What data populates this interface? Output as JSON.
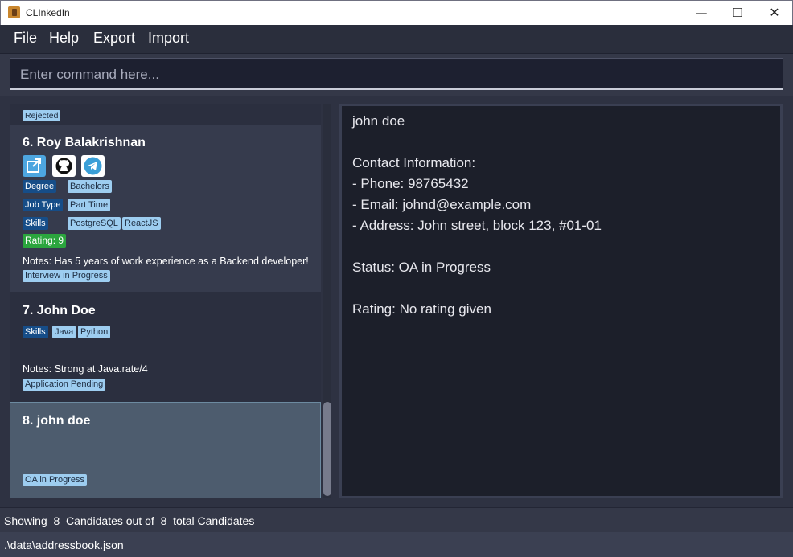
{
  "window": {
    "title": "CLInkedIn",
    "minimize_glyph": "—",
    "maximize_glyph": "☐",
    "close_glyph": "✕"
  },
  "menu": [
    "File",
    "Help",
    "Export",
    "Import"
  ],
  "command": {
    "placeholder": "Enter command here..."
  },
  "list": {
    "partial_card": {
      "status": "Rejected"
    },
    "cards": [
      {
        "index_name": "6.  Roy Balakrishnan",
        "links": [
          "external-link-icon",
          "github-icon",
          "telegram-icon"
        ],
        "degree_label": "Degree",
        "degree_value": "Bachelors",
        "jobtype_label": "Job Type",
        "jobtype_value": "Part Time",
        "skills_label": "Skills",
        "skills": [
          "PostgreSQL",
          "ReactJS"
        ],
        "rating": "Rating: 9",
        "notes": "Notes: Has 5 years of work experience as a Backend developer!",
        "status": "Interview in Progress"
      },
      {
        "index_name": "7.  John Doe",
        "skills_label": "Skills",
        "skills": [
          "Java",
          "Python"
        ],
        "notes": "Notes: Strong at Java.rate/4",
        "status": "Application Pending"
      },
      {
        "index_name": "8.  john doe",
        "status": "OA in Progress"
      }
    ]
  },
  "detail": {
    "name": "john doe",
    "contact_header": "Contact Information:",
    "phone": "- Phone: 98765432",
    "email": "- Email: johnd@example.com",
    "address": "- Address: John street, block 123, #01-01",
    "status": "Status: OA in Progress",
    "rating": "Rating: No rating given"
  },
  "status_bar": {
    "text": "Showing  8  Candidates out of  8  total Candidates"
  },
  "path_bar": {
    "text": ".\\data\\addressbook.json"
  },
  "colors": {
    "tag_dark": "#164d88",
    "tag_light": "#9dcdf0",
    "rating_green": "#2ba53e",
    "selected_card": "#4d5c6e"
  }
}
